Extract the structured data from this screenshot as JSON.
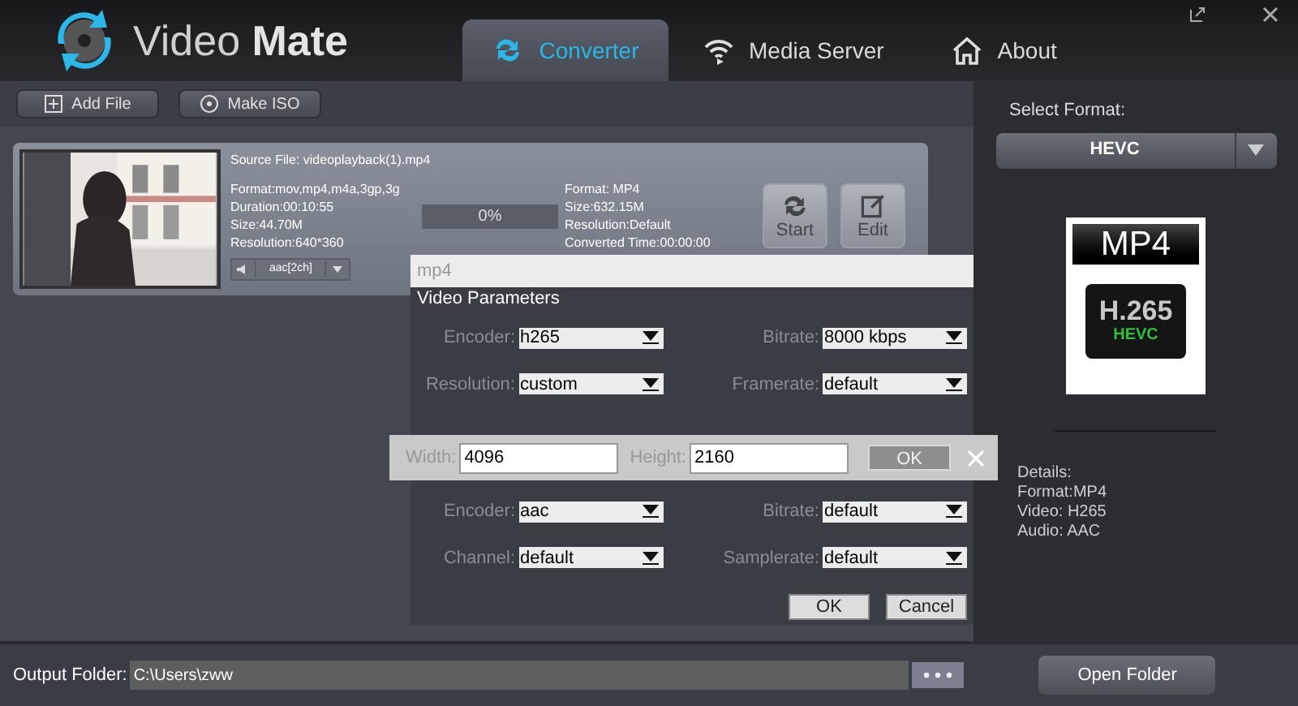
{
  "app": {
    "name_light": "Video",
    "name_bold": "Mate"
  },
  "tabs": [
    {
      "label": "Converter",
      "kind": "converter",
      "selected": true
    },
    {
      "label": "Media Server",
      "kind": "server",
      "selected": false
    },
    {
      "label": "About",
      "kind": "about",
      "selected": false
    }
  ],
  "toolbar": [
    {
      "label": "Add File",
      "kind": "add"
    },
    {
      "label": "Make ISO",
      "kind": "iso"
    }
  ],
  "file": {
    "source": "Source File: videoplayback(1).mp4",
    "source_info": [
      "Format:mov,mp4,m4a,3gp,3g",
      "Duration:00:10:55",
      "Size:44.70M",
      "Resolution:640*360"
    ],
    "progress": {
      "level": 0,
      "text": "0%"
    },
    "target_info": [
      "Format: MP4",
      "Size:632.15M",
      "Resolution:Default",
      "Converted Time:00:00:00"
    ],
    "audio_track": "aac[2ch]",
    "actions": [
      {
        "label": "Start",
        "kind": "start"
      },
      {
        "label": "Edit",
        "kind": "edit"
      }
    ]
  },
  "dialog": {
    "format": "mp4",
    "section": "Video Parameters",
    "video_fields": [
      {
        "label": "Encoder:",
        "value": "h265"
      },
      {
        "label": "Bitrate:",
        "value": "8000 kbps"
      },
      {
        "label": "Resolution:",
        "value": "custom"
      },
      {
        "label": "Framerate:",
        "value": "default"
      }
    ],
    "size_bar": {
      "width_label": "Width:",
      "width_value": "4096",
      "height_label": "Height:",
      "height_value": "2160",
      "ok": {
        "label": "OK",
        "disabled": true
      }
    },
    "audio_fields": [
      {
        "label": "Encoder:",
        "value": "aac"
      },
      {
        "label": "Bitrate:",
        "value": "default"
      },
      {
        "label": "Channel:",
        "value": "default"
      },
      {
        "label": "Samplerate:",
        "value": "default"
      }
    ],
    "buttons": [
      "OK",
      "Cancel"
    ]
  },
  "right_panel": {
    "label": "Select Format:",
    "format": "HEVC",
    "badge_top": "MP4",
    "badge_codec": "H.265",
    "badge_sub": "HEVC",
    "details": [
      "Details:",
      "Format:MP4",
      "Video: H265",
      "Audio: AAC"
    ]
  },
  "bottom": {
    "label": "Output Folder:",
    "path": "C:\\Users\\zww",
    "open_folder": "Open Folder"
  }
}
